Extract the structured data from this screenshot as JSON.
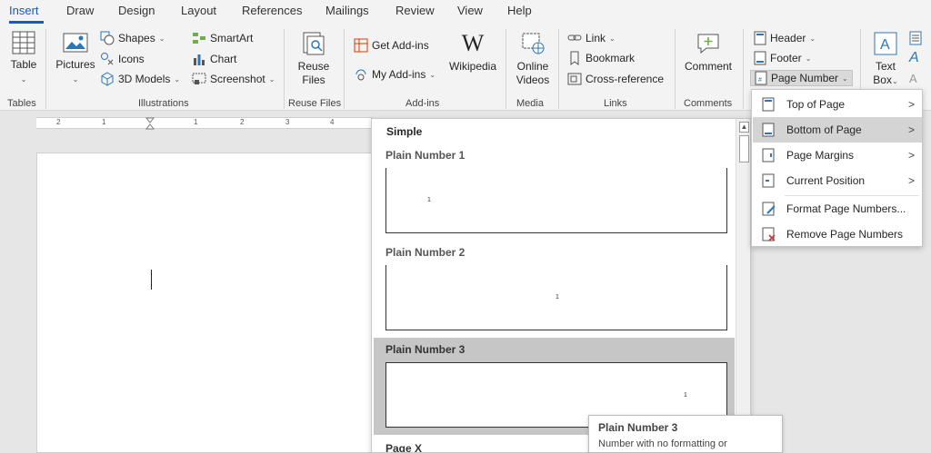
{
  "tabs": [
    {
      "label": "Insert",
      "active": true
    },
    {
      "label": "Draw"
    },
    {
      "label": "Design"
    },
    {
      "label": "Layout"
    },
    {
      "label": "References"
    },
    {
      "label": "Mailings"
    },
    {
      "label": "Review"
    },
    {
      "label": "View"
    },
    {
      "label": "Help"
    }
  ],
  "ribbon": {
    "tables": {
      "table": "Table",
      "group": "Tables"
    },
    "illustrations": {
      "pictures": "Pictures",
      "shapes": "Shapes",
      "icons": "Icons",
      "models": "3D Models",
      "smartart": "SmartArt",
      "chart": "Chart",
      "screenshot": "Screenshot",
      "group": "Illustrations"
    },
    "reuse": {
      "line1": "Reuse",
      "line2": "Files",
      "group": "Reuse Files"
    },
    "addins": {
      "get": "Get Add-ins",
      "my": "My Add-ins",
      "wikipedia": "Wikipedia",
      "group": "Add-ins"
    },
    "media": {
      "line1": "Online",
      "line2": "Videos",
      "group": "Media"
    },
    "links": {
      "link": "Link",
      "bookmark": "Bookmark",
      "crossref": "Cross-reference",
      "group": "Links"
    },
    "comments": {
      "comment": "Comment",
      "group": "Comments"
    },
    "headerfooter": {
      "header": "Header",
      "footer": "Footer",
      "pagenumber": "Page Number"
    },
    "text": {
      "line1": "Text",
      "line2": "Box"
    }
  },
  "ruler": {
    "labels": [
      "2",
      "1",
      "1",
      "2",
      "3",
      "4"
    ]
  },
  "gallery": {
    "heading": "Simple",
    "items": [
      {
        "title": "Plain Number 1",
        "num": "1",
        "selected": false
      },
      {
        "title": "Plain Number 2",
        "num": "1",
        "selected": false
      },
      {
        "title": "Plain Number 3",
        "num": "1",
        "selected": true
      },
      {
        "title": "Page X"
      }
    ]
  },
  "tooltip": {
    "title": "Plain Number 3",
    "desc": "Number with no formatting or"
  },
  "menu": {
    "items": [
      {
        "label": "Top of Page",
        "has_submenu": true
      },
      {
        "label": "Bottom of Page",
        "has_submenu": true,
        "highlighted": true
      },
      {
        "label": "Page Margins",
        "has_submenu": true
      },
      {
        "label": "Current Position",
        "has_submenu": true
      },
      {
        "label": "Format Page Numbers...",
        "has_submenu": false
      },
      {
        "label": "Remove Page Numbers",
        "has_submenu": false
      }
    ]
  },
  "colors": {
    "accent": "#185abd",
    "ribbon_bg": "#f3f3f3",
    "highlight": "#d4d4d4"
  }
}
